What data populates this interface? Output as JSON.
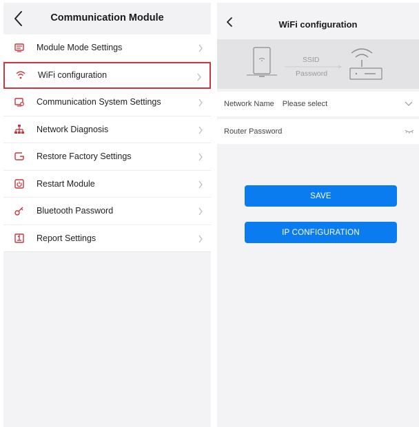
{
  "left": {
    "title": "Communication Module",
    "items": [
      {
        "label": "Module Mode Settings",
        "icon": "module-mode-icon"
      },
      {
        "label": "WiFi configuration",
        "icon": "wifi-icon"
      },
      {
        "label": "Communication System Settings",
        "icon": "communication-system-icon"
      },
      {
        "label": "Network Diagnosis",
        "icon": "network-diagnosis-icon"
      },
      {
        "label": "Restore Factory Settings",
        "icon": "restore-icon"
      },
      {
        "label": "Restart Module",
        "icon": "restart-icon"
      },
      {
        "label": "Bluetooth Password",
        "icon": "key-icon"
      },
      {
        "label": "Report Settings",
        "icon": "report-icon"
      }
    ],
    "selected_index": 1
  },
  "right": {
    "title": "WiFi configuration",
    "banner": {
      "ssid_label": "SSID",
      "password_label": "Password"
    },
    "network_name": {
      "label": "Network Name",
      "value": "Please select"
    },
    "router_password": {
      "label": "Router Password"
    },
    "save_label": "SAVE",
    "ip_label": "IP CONFIGURATION"
  },
  "colors": {
    "accent": "#0b7cf0",
    "icon_red": "#c9363f",
    "selected_border": "#c9363f",
    "panel_bg": "#f3f3f5"
  }
}
